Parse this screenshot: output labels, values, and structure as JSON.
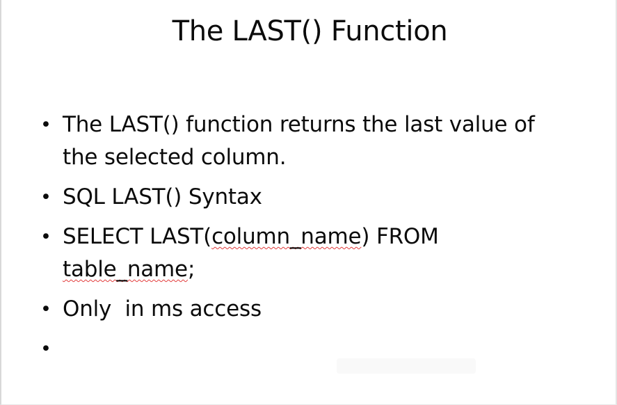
{
  "slide": {
    "title": "The LAST() Function",
    "bullets": [
      {
        "lines": [
          "The LAST() function returns the last value of",
          "the selected column."
        ]
      },
      {
        "lines": [
          "SQL LAST() Syntax"
        ]
      },
      {
        "line1_prefix": "SELECT LAST(",
        "line1_spell": "column_name",
        "line1_suffix": ") FROM",
        "line2_spell": "table_name",
        "line2_suffix": ";"
      },
      {
        "lines": [
          "Only  in ms access"
        ]
      },
      {
        "lines": [
          ""
        ]
      }
    ],
    "bullet_glyph": "•"
  },
  "colors": {
    "text": "#0b0b0b",
    "spellcheck_underline": "#e23b3b",
    "background": "#ffffff"
  }
}
